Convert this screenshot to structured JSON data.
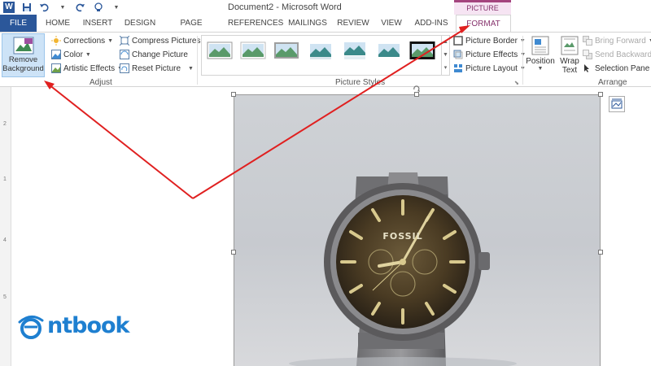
{
  "window": {
    "title": "Document2 - Microsoft Word",
    "context_tab_group": "PICTURE TOOLS"
  },
  "tabs": [
    "FILE",
    "HOME",
    "INSERT",
    "DESIGN",
    "PAGE LAYOUT",
    "REFERENCES",
    "MAILINGS",
    "REVIEW",
    "VIEW",
    "ADD-INS",
    "FORMAT"
  ],
  "ribbon": {
    "adjust": {
      "label": "Adjust",
      "remove_background": "Remove Background",
      "corrections": "Corrections",
      "color": "Color",
      "artistic_effects": "Artistic Effects",
      "compress_pictures": "Compress Pictures",
      "change_picture": "Change Picture",
      "reset_picture": "Reset Picture"
    },
    "picture_styles": {
      "label": "Picture Styles",
      "picture_border": "Picture Border",
      "picture_effects": "Picture Effects",
      "picture_layout": "Picture Layout"
    },
    "arrange": {
      "label": "Arrange",
      "position": "Position",
      "wrap_text": "Wrap Text",
      "bring_forward": "Bring Forward",
      "send_backward": "Send Backward",
      "selection_pane": "Selection Pane"
    }
  },
  "ruler": [
    "2",
    "1",
    "4",
    "5"
  ],
  "photo": {
    "brand_text": "FOSSIL"
  },
  "watermark": {
    "text": "ntbook"
  },
  "colors": {
    "word_blue": "#2b579a",
    "format_accent": "#86336d",
    "arrow_red": "#e02020",
    "highlight": "#cde3f7"
  }
}
